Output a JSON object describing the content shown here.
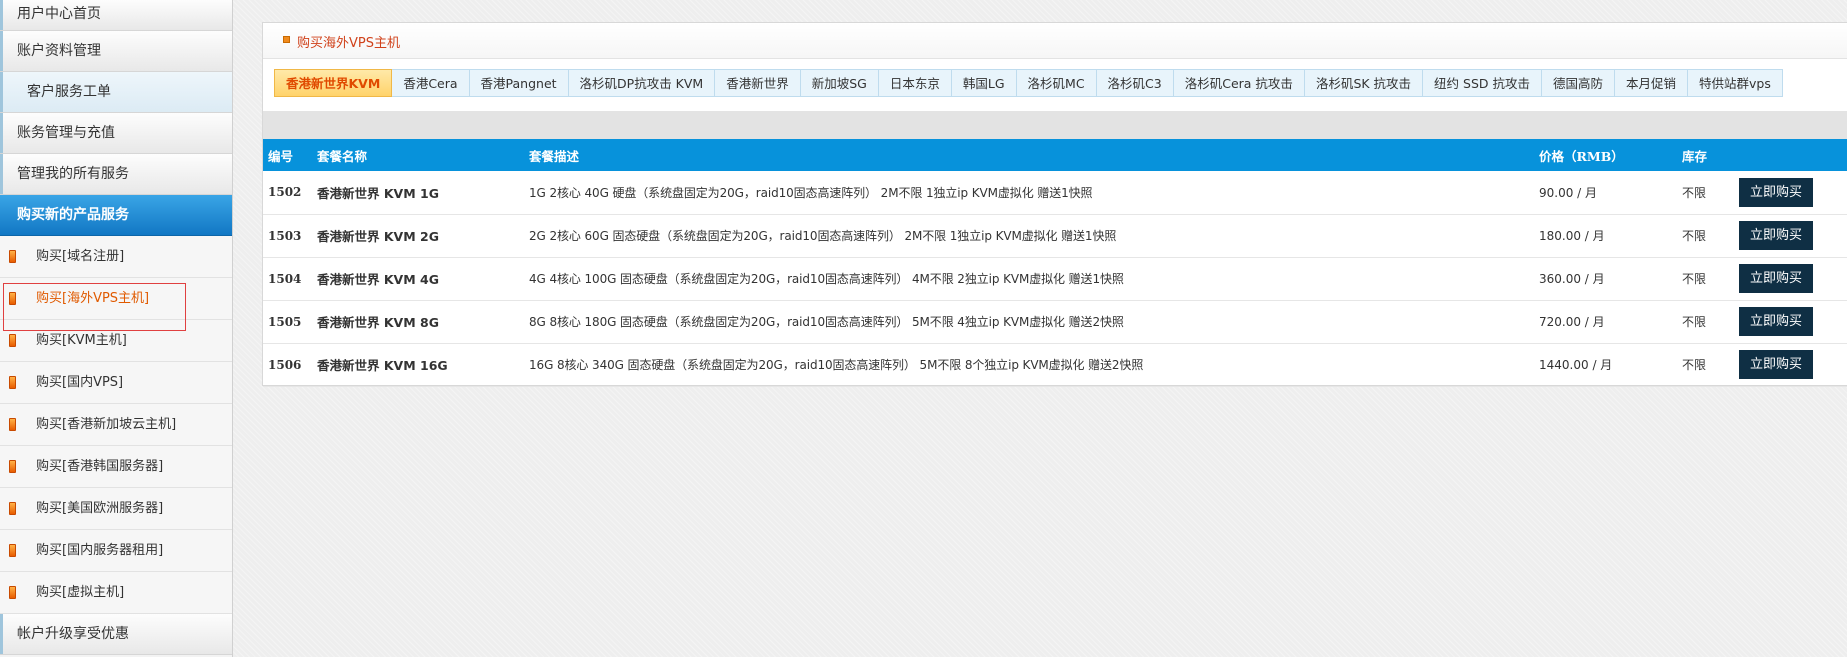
{
  "sidebar": {
    "menu": [
      {
        "label": "用户中心首页"
      },
      {
        "label": "账户资料管理"
      },
      {
        "label": "客户服务工单"
      },
      {
        "label": "账务管理与充值"
      },
      {
        "label": "管理我的所有服务"
      },
      {
        "label": "购买新的产品服务"
      }
    ],
    "sub_items": [
      {
        "label": "购买[域名注册]"
      },
      {
        "label": "购买[海外VPS主机]"
      },
      {
        "label": "购买[KVM主机]"
      },
      {
        "label": "购买[国内VPS]"
      },
      {
        "label": "购买[香港新加坡云主机]"
      },
      {
        "label": "购买[香港韩国服务器]"
      },
      {
        "label": "购买[美国欧洲服务器]"
      },
      {
        "label": "购买[国内服务器租用]"
      },
      {
        "label": "购买[虚拟主机]"
      }
    ],
    "bottom": {
      "label": "帐户升级享受优惠"
    }
  },
  "panel": {
    "title": "购买海外VPS主机",
    "tabs": [
      {
        "label": "香港新世界KVM"
      },
      {
        "label": "香港Cera"
      },
      {
        "label": "香港Pangnet"
      },
      {
        "label": "洛杉矶DP抗攻击 KVM"
      },
      {
        "label": "香港新世界"
      },
      {
        "label": "新加坡SG"
      },
      {
        "label": "日本东京"
      },
      {
        "label": "韩国LG"
      },
      {
        "label": "洛杉矶MC"
      },
      {
        "label": "洛杉矶C3"
      },
      {
        "label": "洛杉矶Cera 抗攻击"
      },
      {
        "label": "洛杉矶SK 抗攻击"
      },
      {
        "label": "纽约 SSD 抗攻击"
      },
      {
        "label": "德国高防"
      },
      {
        "label": "本月促销"
      },
      {
        "label": "特供站群vps"
      }
    ],
    "table": {
      "headers": {
        "id": "编号",
        "name": "套餐名称",
        "desc": "套餐描述",
        "price": "价格（RMB）",
        "stock": "库存"
      },
      "rows": [
        {
          "id": "1502",
          "name": "香港新世界 KVM 1G",
          "desc": "1G 2核心 40G 硬盘（系统盘固定为20G，raid10固态高速阵列） 2M不限 1独立ip KVM虚拟化 赠送1快照",
          "price": "90.00 / 月",
          "stock": "不限",
          "button": "立即购买"
        },
        {
          "id": "1503",
          "name": "香港新世界 KVM 2G",
          "desc": "2G 2核心 60G 固态硬盘（系统盘固定为20G，raid10固态高速阵列） 2M不限 1独立ip KVM虚拟化 赠送1快照",
          "price": "180.00 / 月",
          "stock": "不限",
          "button": "立即购买"
        },
        {
          "id": "1504",
          "name": "香港新世界 KVM 4G",
          "desc": "4G 4核心 100G 固态硬盘（系统盘固定为20G，raid10固态高速阵列） 4M不限 2独立ip KVM虚拟化 赠送1快照",
          "price": "360.00 / 月",
          "stock": "不限",
          "button": "立即购买"
        },
        {
          "id": "1505",
          "name": "香港新世界 KVM 8G",
          "desc": "8G 8核心 180G 固态硬盘（系统盘固定为20G，raid10固态高速阵列） 5M不限 4独立ip KVM虚拟化 赠送2快照",
          "price": "720.00 / 月",
          "stock": "不限",
          "button": "立即购买"
        },
        {
          "id": "1506",
          "name": "香港新世界 KVM 16G",
          "desc": "16G 8核心 340G 固态硬盘（系统盘固定为20G，raid10固态高速阵列） 5M不限 8个独立ip KVM虚拟化 赠送2快照",
          "price": "1440.00 / 月",
          "stock": "不限",
          "button": "立即购买"
        }
      ]
    }
  },
  "colors": {
    "accent_blue": "#0792db",
    "active_orange": "#e04a00",
    "title_red": "#d0421b",
    "button_dark": "#0f2f44"
  }
}
